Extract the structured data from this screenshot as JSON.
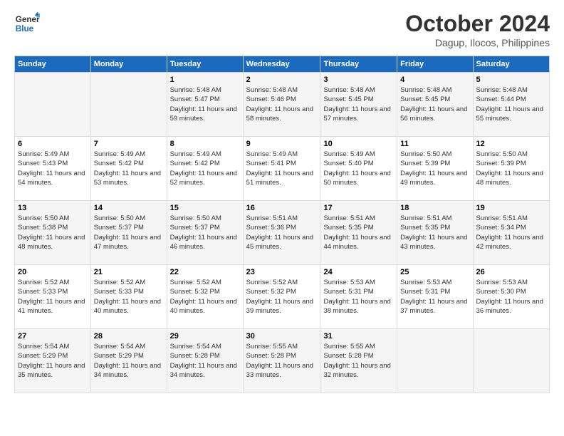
{
  "logo": {
    "line1": "General",
    "line2": "Blue"
  },
  "title": "October 2024",
  "subtitle": "Dagup, Ilocos, Philippines",
  "weekdays": [
    "Sunday",
    "Monday",
    "Tuesday",
    "Wednesday",
    "Thursday",
    "Friday",
    "Saturday"
  ],
  "weeks": [
    [
      {
        "day": "",
        "info": ""
      },
      {
        "day": "",
        "info": ""
      },
      {
        "day": "1",
        "info": "Sunrise: 5:48 AM\nSunset: 5:47 PM\nDaylight: 11 hours and 59 minutes."
      },
      {
        "day": "2",
        "info": "Sunrise: 5:48 AM\nSunset: 5:46 PM\nDaylight: 11 hours and 58 minutes."
      },
      {
        "day": "3",
        "info": "Sunrise: 5:48 AM\nSunset: 5:45 PM\nDaylight: 11 hours and 57 minutes."
      },
      {
        "day": "4",
        "info": "Sunrise: 5:48 AM\nSunset: 5:45 PM\nDaylight: 11 hours and 56 minutes."
      },
      {
        "day": "5",
        "info": "Sunrise: 5:48 AM\nSunset: 5:44 PM\nDaylight: 11 hours and 55 minutes."
      }
    ],
    [
      {
        "day": "6",
        "info": "Sunrise: 5:49 AM\nSunset: 5:43 PM\nDaylight: 11 hours and 54 minutes."
      },
      {
        "day": "7",
        "info": "Sunrise: 5:49 AM\nSunset: 5:42 PM\nDaylight: 11 hours and 53 minutes."
      },
      {
        "day": "8",
        "info": "Sunrise: 5:49 AM\nSunset: 5:42 PM\nDaylight: 11 hours and 52 minutes."
      },
      {
        "day": "9",
        "info": "Sunrise: 5:49 AM\nSunset: 5:41 PM\nDaylight: 11 hours and 51 minutes."
      },
      {
        "day": "10",
        "info": "Sunrise: 5:49 AM\nSunset: 5:40 PM\nDaylight: 11 hours and 50 minutes."
      },
      {
        "day": "11",
        "info": "Sunrise: 5:50 AM\nSunset: 5:39 PM\nDaylight: 11 hours and 49 minutes."
      },
      {
        "day": "12",
        "info": "Sunrise: 5:50 AM\nSunset: 5:39 PM\nDaylight: 11 hours and 48 minutes."
      }
    ],
    [
      {
        "day": "13",
        "info": "Sunrise: 5:50 AM\nSunset: 5:38 PM\nDaylight: 11 hours and 48 minutes."
      },
      {
        "day": "14",
        "info": "Sunrise: 5:50 AM\nSunset: 5:37 PM\nDaylight: 11 hours and 47 minutes."
      },
      {
        "day": "15",
        "info": "Sunrise: 5:50 AM\nSunset: 5:37 PM\nDaylight: 11 hours and 46 minutes."
      },
      {
        "day": "16",
        "info": "Sunrise: 5:51 AM\nSunset: 5:36 PM\nDaylight: 11 hours and 45 minutes."
      },
      {
        "day": "17",
        "info": "Sunrise: 5:51 AM\nSunset: 5:35 PM\nDaylight: 11 hours and 44 minutes."
      },
      {
        "day": "18",
        "info": "Sunrise: 5:51 AM\nSunset: 5:35 PM\nDaylight: 11 hours and 43 minutes."
      },
      {
        "day": "19",
        "info": "Sunrise: 5:51 AM\nSunset: 5:34 PM\nDaylight: 11 hours and 42 minutes."
      }
    ],
    [
      {
        "day": "20",
        "info": "Sunrise: 5:52 AM\nSunset: 5:33 PM\nDaylight: 11 hours and 41 minutes."
      },
      {
        "day": "21",
        "info": "Sunrise: 5:52 AM\nSunset: 5:33 PM\nDaylight: 11 hours and 40 minutes."
      },
      {
        "day": "22",
        "info": "Sunrise: 5:52 AM\nSunset: 5:32 PM\nDaylight: 11 hours and 40 minutes."
      },
      {
        "day": "23",
        "info": "Sunrise: 5:52 AM\nSunset: 5:32 PM\nDaylight: 11 hours and 39 minutes."
      },
      {
        "day": "24",
        "info": "Sunrise: 5:53 AM\nSunset: 5:31 PM\nDaylight: 11 hours and 38 minutes."
      },
      {
        "day": "25",
        "info": "Sunrise: 5:53 AM\nSunset: 5:31 PM\nDaylight: 11 hours and 37 minutes."
      },
      {
        "day": "26",
        "info": "Sunrise: 5:53 AM\nSunset: 5:30 PM\nDaylight: 11 hours and 36 minutes."
      }
    ],
    [
      {
        "day": "27",
        "info": "Sunrise: 5:54 AM\nSunset: 5:29 PM\nDaylight: 11 hours and 35 minutes."
      },
      {
        "day": "28",
        "info": "Sunrise: 5:54 AM\nSunset: 5:29 PM\nDaylight: 11 hours and 34 minutes."
      },
      {
        "day": "29",
        "info": "Sunrise: 5:54 AM\nSunset: 5:28 PM\nDaylight: 11 hours and 34 minutes."
      },
      {
        "day": "30",
        "info": "Sunrise: 5:55 AM\nSunset: 5:28 PM\nDaylight: 11 hours and 33 minutes."
      },
      {
        "day": "31",
        "info": "Sunrise: 5:55 AM\nSunset: 5:28 PM\nDaylight: 11 hours and 32 minutes."
      },
      {
        "day": "",
        "info": ""
      },
      {
        "day": "",
        "info": ""
      }
    ]
  ]
}
